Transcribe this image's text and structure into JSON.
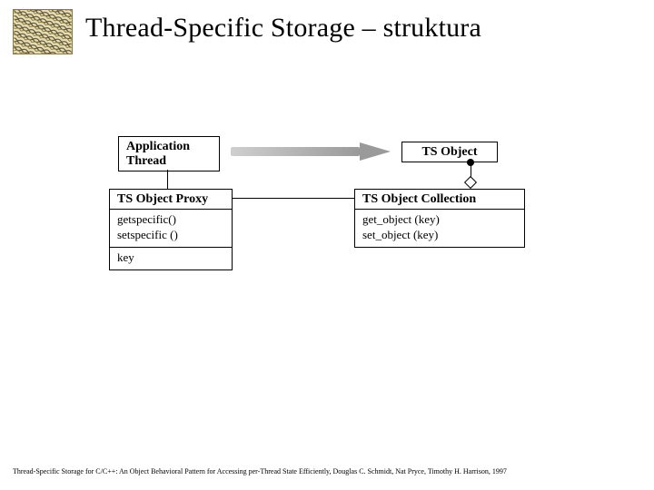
{
  "header": {
    "title": "Thread-Specific Storage – struktura"
  },
  "diagram": {
    "app_thread": {
      "label": "Application\nThread"
    },
    "ts_object": {
      "label": "TS Object"
    },
    "proxy": {
      "label": "TS Object Proxy",
      "methods": "getspecific()\nsetspecific ()",
      "attrs": "key"
    },
    "collection": {
      "label": "TS Object Collection",
      "methods": "get_object (key)\nset_object (key)"
    }
  },
  "footer": {
    "citation": "Thread-Specific Storage for C/C++: An Object Behavioral Pattern for Accessing per-Thread State Efficiently, Douglas C. Schmidt, Nat Pryce, Timothy H. Harrison, 1997"
  }
}
